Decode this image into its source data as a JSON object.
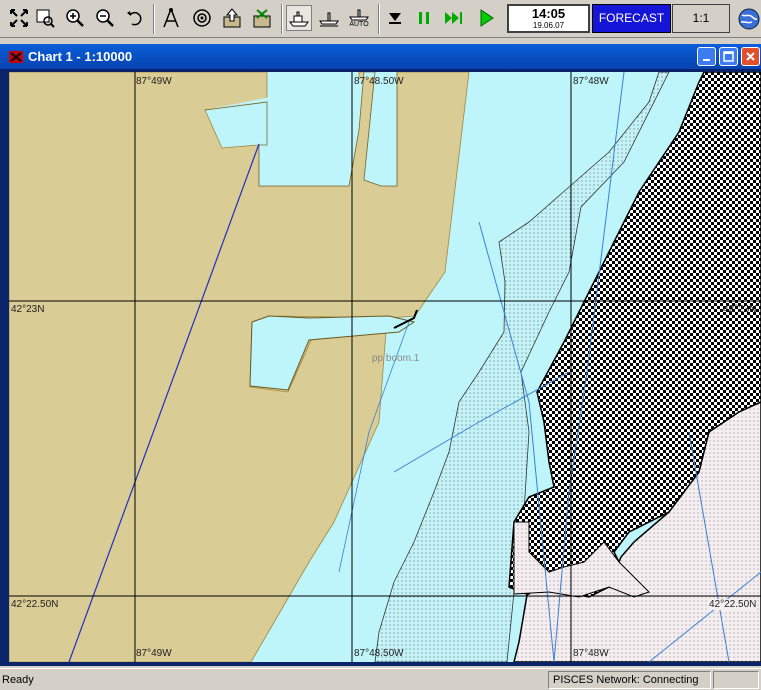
{
  "toolbar": {
    "buttons": [
      {
        "name": "fit-chart-icon"
      },
      {
        "name": "zoom-window-icon"
      },
      {
        "name": "zoom-in-icon"
      },
      {
        "name": "zoom-out-icon"
      },
      {
        "name": "undo-icon"
      },
      {
        "name": "compass-icon"
      },
      {
        "name": "target-icon"
      },
      {
        "name": "export-icon"
      },
      {
        "name": "layers-icon"
      },
      {
        "name": "ship-mode-icon"
      },
      {
        "name": "ship-mode-2-icon"
      },
      {
        "name": "auto-mode-icon"
      },
      {
        "name": "down-icon"
      },
      {
        "name": "pause-icon"
      },
      {
        "name": "fast-forward-icon"
      },
      {
        "name": "play-icon"
      }
    ],
    "auto_label": "AUTO",
    "clock_time": "14:05",
    "clock_date": "19.06.07",
    "forecast_label": "FORECAST",
    "scale_label": "1:1"
  },
  "window": {
    "title": "Chart 1 - 1:10000"
  },
  "chart": {
    "lon_labels": [
      "87°49W",
      "87°48.50W",
      "87°48W"
    ],
    "lat_labels": [
      "42°23N",
      "42°22.50N"
    ],
    "right_labels": [
      "42°23N",
      "42°22.50N"
    ],
    "object_label": "pp boom.1",
    "colors": {
      "land": "#d9cc94",
      "water": "#bdf5fa",
      "dotted_shoal": "#c8f0f4",
      "grid": "#000000"
    }
  },
  "status": {
    "ready": "Ready",
    "network": "PISCES Network: Connecting"
  }
}
